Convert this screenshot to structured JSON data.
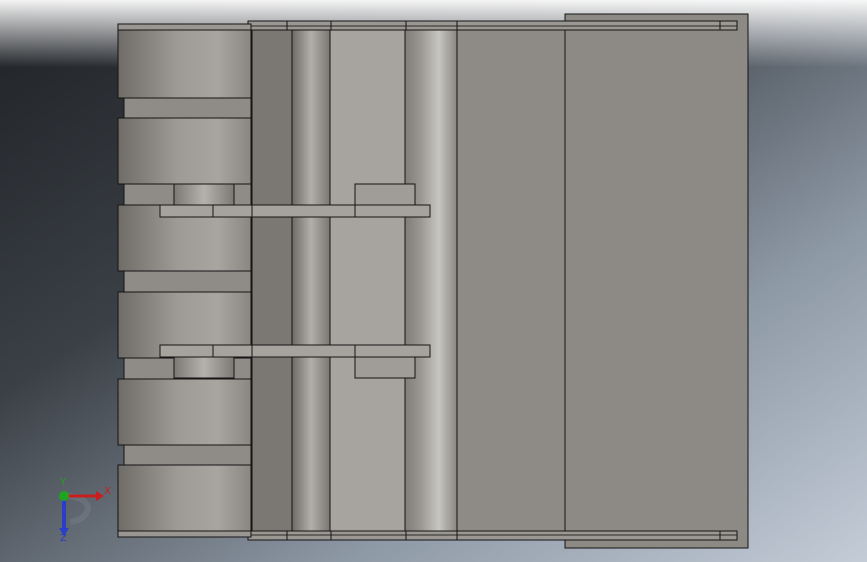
{
  "viewport": {
    "background_top": "#f2f4f7",
    "background_left": "#26292d",
    "background_right": "#aebac9",
    "part_colors": {
      "face_dark": "#7b7874",
      "face_mid": "#8f8c86",
      "face_light": "#a9a6a1",
      "edge": "#141414",
      "highlight": "#d7d5d0"
    }
  },
  "triad": {
    "x_label": "X",
    "y_label": "Y",
    "z_label": "Z",
    "x_color": "#c81e1e",
    "y_color": "#1ea41e",
    "z_color": "#2a3ec8"
  }
}
